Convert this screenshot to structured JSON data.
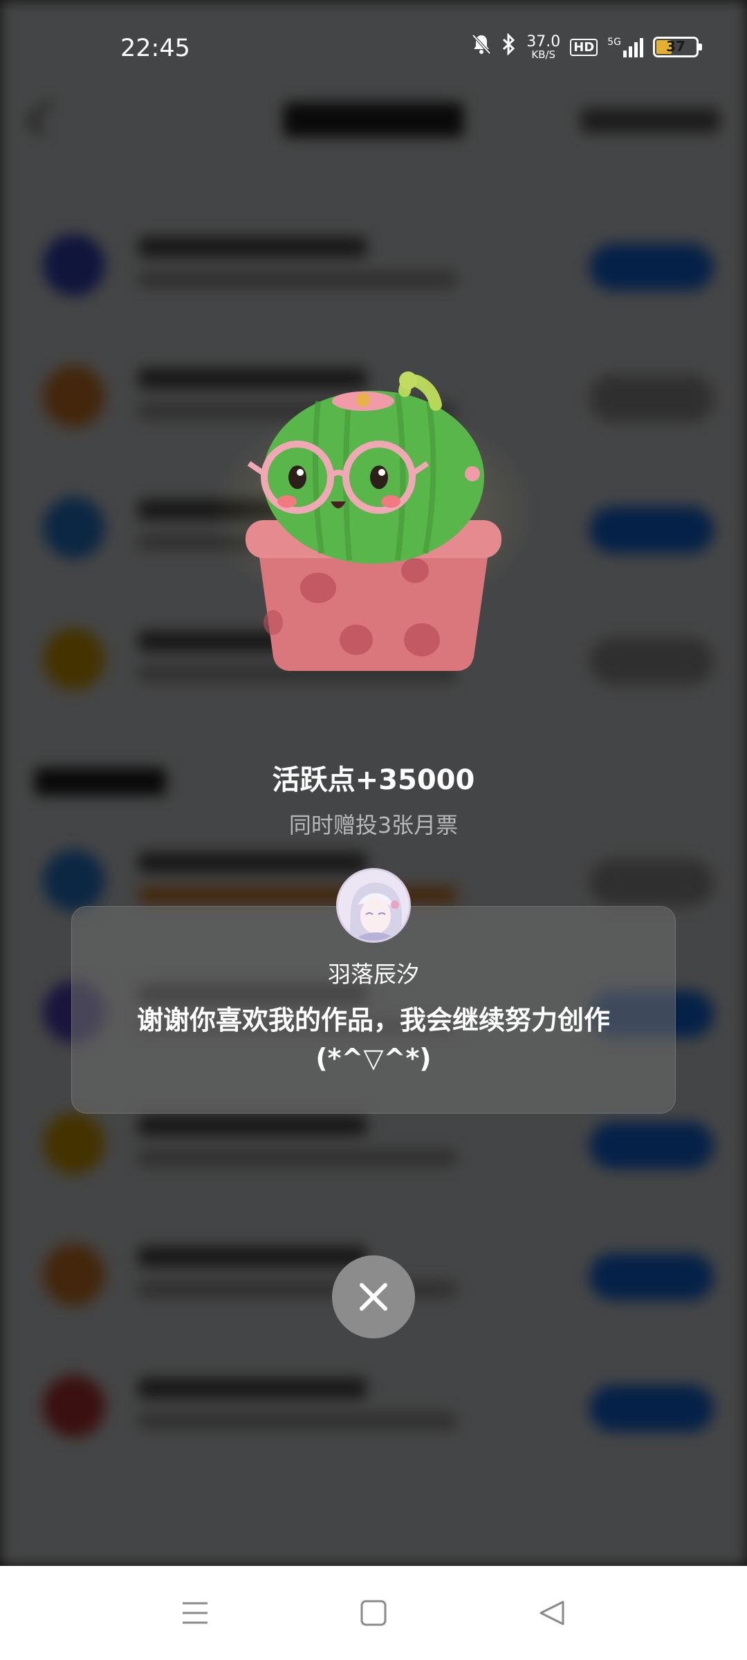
{
  "status_bar": {
    "time": "22:45",
    "net_speed_value": "37.0",
    "net_speed_unit": "KB/S",
    "hd_label": "HD",
    "network_type": "5G",
    "battery_level": "37",
    "icons": [
      "mute-bell-icon",
      "bluetooth-icon",
      "signal-icon",
      "battery-icon"
    ]
  },
  "reward": {
    "title": "活跃点+35000",
    "subtitle": "同时赠投3张月票"
  },
  "message_card": {
    "author": "羽落辰汐",
    "message": "谢谢你喜欢我的作品，我会继续努力创作(*^▽^*)"
  },
  "close": {
    "icon": "close-icon"
  },
  "nav_bar": {
    "icons": [
      "menu-icon",
      "home-square-icon",
      "back-triangle-icon"
    ]
  },
  "colors": {
    "overlay": "#000000",
    "accent_button": "#1677ff",
    "battery_fill": "#e3b12d",
    "close_button": "#8c8c8c"
  }
}
